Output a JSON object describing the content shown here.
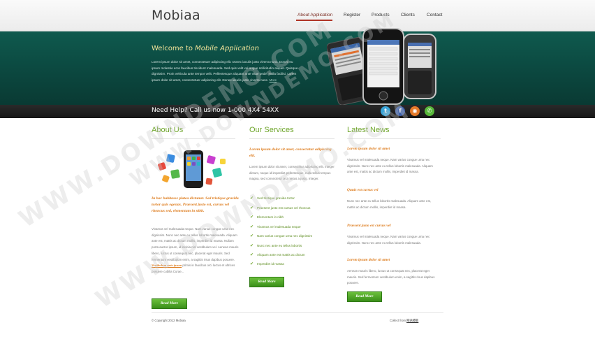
{
  "brand": {
    "logo": "Mobiaa"
  },
  "nav": [
    {
      "label": "About Application",
      "active": true
    },
    {
      "label": "Register",
      "active": false
    },
    {
      "label": "Products",
      "active": false
    },
    {
      "label": "Clients",
      "active": false
    },
    {
      "label": "Contact",
      "active": false
    }
  ],
  "hero": {
    "title_prefix": "Welcome to ",
    "title_em": "Mobile Application",
    "text": "Lorem ipsum dolor sit amet, consectetuer adipiscing elit. Donec iaculis justo viverra nunc. Donec eu ipsum molestie eros faucibus tincidunt malesuada. Sed quis velit vel augue sollicitudin aliquet. Quisque dignissim. Proin vehicula ante tempor velit. Pellentesque aliquam ante vitae pede. Nulla facilisi. Lorem ipsum dolor sit amet, consectetuer adipiscing elit. Donec iaculis justo viverra nunc.",
    "more": "More"
  },
  "helpbar": {
    "text": "Need Help? Call us now 1-000 4X4 54XX",
    "social_icons": [
      "twitter-icon",
      "facebook-icon",
      "rss-icon",
      "chat-icon"
    ]
  },
  "about": {
    "title": "About Us",
    "intro": "In hac habitasse platea dictumst. Sed tristique gravida tortor quis egestas. Praesent justo est, cursus vel rhoncus sed, elementum in nibh.",
    "body": "Vivamus vel malesuada neque. Nam varius congue urna nec dignissim. Nunc nec ante eu tellus lobortis malesuada. Aliquam ante est, mattis ac dictum mollis, imperdiet id massa. Nullam porta auctor ipsum, id lacinia nisl vestibulum vel. Aenean mauris libero, luctus ut consequat nec, placerat eget mauris. Sed fermentum vestibulum enim, a sagittis risus dapibus posuere.",
    "body_link": "Vestibulum ante ipsum",
    "body_tail": "primis in faucibus orci luctus et ultrices posuere cubilia Curae...",
    "button": "Read More"
  },
  "services": {
    "title": "Our Services",
    "intro": "Lorem ipsum dolor sit amet, consectetur adipiscing elit.",
    "body": "Lorem ipsum dolor sit amet, consectetur adipiscing elit. Integer dictum, neque id imperdiet pellentesque, nulla tellus tempus magna, sed consectetur orci metus a justo. Integer.",
    "items": [
      "Sed tristique gravida tortor",
      "Praesent justo est cursus vel rhoncus",
      "Elementum in nibh",
      "Vivamus vel malesuada neque",
      "Nam varius congue urna nec dignissim",
      "Nunc nec ante eu tellus lobortis",
      "Aliquam ante est mattis ac dictum",
      "Imperdiet id massa"
    ],
    "button": "Read More"
  },
  "news": {
    "title": "Latest News",
    "items": [
      {
        "heading": "Lorem ipsum dolor sit amet",
        "text": "Vivamus vel malesuada neque. Nam varius congue urna nec dignissim. Nunc nec ante eu tellus lobortis malesuada. Aliquam ante est, mattis ac dictum mollis, imperdiet id massa."
      },
      {
        "heading": "Quuis est cursus vel",
        "text": "Nunc nec ante eu tellus lobortis malesuada. Aliquam ante est, mattis ac dictum mollis, imperdiet id massa."
      },
      {
        "heading": "Praesent justo est cursus vel",
        "text": "Vivamus vel malesuada neque. Nam varius congue urna nec dignissim. Nunc nec ante eu tellus lobortis malesuada."
      },
      {
        "heading": "Lorem ipsum dolor sit amet",
        "text": "Aenean mauris libero, luctus ut consequat nec, placerat eget mauris. Sed fermentum vestibulum enim, a sagittis risus dapibus posuere."
      }
    ],
    "button": "Read More"
  },
  "footer": {
    "copyright": "© Copyright 2012 Mobiaa",
    "collect_label": "Collect from",
    "collect_link": "网站模板"
  },
  "watermark": "WWW.DOWNDEMO.COM",
  "colors": {
    "accent_green": "#6ea52a",
    "accent_orange": "#dd7a1a",
    "hero_bg": "#0b463e",
    "nav_active": "#b03325"
  }
}
